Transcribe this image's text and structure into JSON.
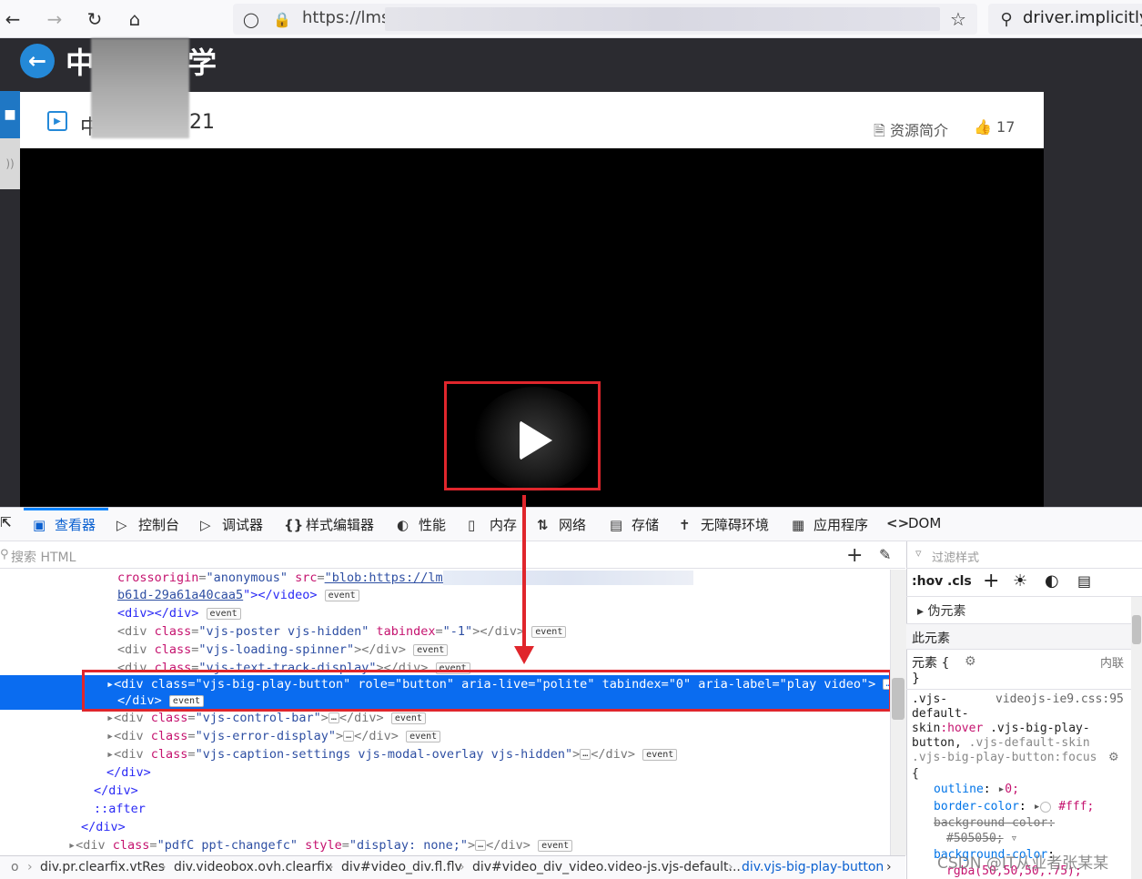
{
  "browser": {
    "url": "https://lms",
    "search": "driver.implicitly_"
  },
  "page": {
    "logo_left": "中",
    "logo_right": "学",
    "video_title_left": "中",
    "video_title_right": "21",
    "resource_intro": "资源简介",
    "likes": "17"
  },
  "devtools": {
    "tabs": [
      {
        "label": "查看器"
      },
      {
        "label": "控制台"
      },
      {
        "label": "调试器"
      },
      {
        "label": "样式编辑器"
      },
      {
        "label": "性能"
      },
      {
        "label": "内存"
      },
      {
        "label": "网络"
      },
      {
        "label": "存储"
      },
      {
        "label": "无障碍环境"
      },
      {
        "label": "应用程序"
      },
      {
        "label": "DOM"
      }
    ],
    "search_placeholder": "搜索 HTML",
    "event": "event",
    "dom": {
      "l1_attr1": "crossorigin",
      "l1_val1": "\"anonymous\"",
      "l1_attr2": "src",
      "l1_val2": "\"blob:https://lms",
      "l2_val": "b61d-29a61a40caa5",
      "l2_close": "\"></video>",
      "l3": "<div></div>",
      "l4_cls": "\"vjs-poster vjs-hidden\"",
      "l4_tab": "\"-1\"",
      "l5_cls": "\"vjs-loading-spinner\"",
      "l6_cls": "\"vjs-text-track-display\"",
      "sel_open": "<div class=\"vjs-big-play-button\" role=\"button\" aria-live=\"polite\" tabindex=\"0\" aria-label=\"play video\">",
      "sel_close": "</div>",
      "l8_cls": "\"vjs-control-bar\"",
      "l9_cls": "\"vjs-error-display\"",
      "l10_cls": "\"vjs-caption-settings vjs-modal-overlay vjs-hidden\"",
      "close_div": "</div>",
      "after": "::after",
      "l14_cls": "\"pdfC ppt-changefc\"",
      "l14_style": "\"display: none;\""
    },
    "breadcrumbs": [
      "o",
      "div.pr.clearfix.vtRes",
      "div.videobox.ovh.clearfix",
      "div#video_div.fl.flv",
      "div#video_div_video.video-js.vjs-default...",
      "div.vjs-big-play-button"
    ],
    "styles": {
      "filter_placeholder": "过滤样式",
      "hov": ":hov",
      "cls": ".cls",
      "pseudo_elements": "伪元素",
      "this_element": "此元素",
      "element_label": "元素 {",
      "inline": "内联",
      "close_brace": "}",
      "sel_line1": ".vjs-",
      "source": "videojs-ie9.css:95",
      "sel_line2": "default-",
      "sel_line3a": "skin",
      "sel_line3b": ":hover",
      "sel_line3c": " .vjs-big-play-",
      "sel_line4": "button,",
      "sel_line4b": " .vjs-default-skin",
      "sel_line5": ".vjs-big-play-button:focus",
      "open_brace": "{",
      "p1": "outline",
      "v1": "0;",
      "p2": "border-color",
      "v2": "#fff;",
      "p3": "background-color",
      "v3": "#505050;",
      "p4": "background-color",
      "v4": "rgba(50,50,50,.75);"
    }
  },
  "watermark": "CSDN @IT从业者张某某"
}
